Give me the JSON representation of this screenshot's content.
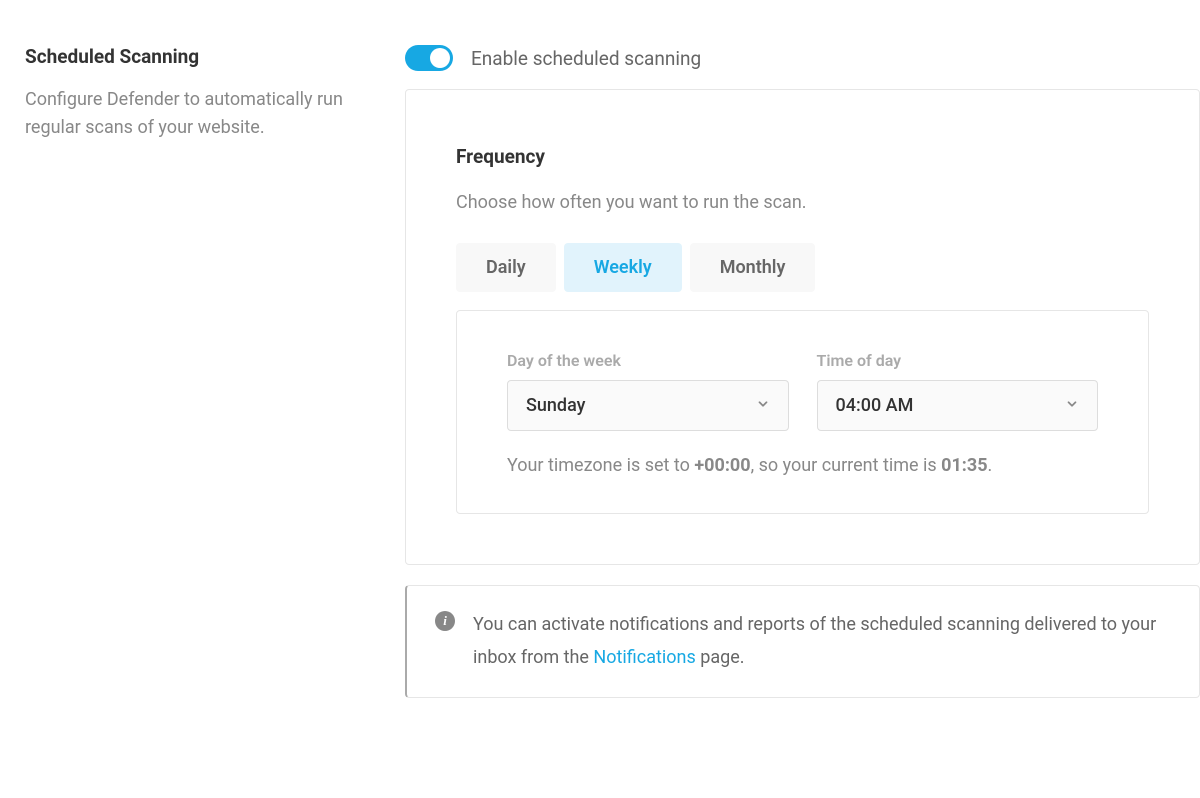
{
  "section": {
    "title": "Scheduled Scanning",
    "description": "Configure Defender to automatically run regular scans of your website."
  },
  "toggle": {
    "label": "Enable scheduled scanning",
    "checked": true
  },
  "frequency": {
    "heading": "Frequency",
    "subtext": "Choose how often you want to run the scan.",
    "tabs": {
      "daily": "Daily",
      "weekly": "Weekly",
      "monthly": "Monthly",
      "active": "weekly"
    },
    "day_label": "Day of the week",
    "day_value": "Sunday",
    "time_label": "Time of day",
    "time_value": "04:00 AM",
    "tz_prefix": "Your timezone is set to ",
    "tz_value": "+00:00",
    "tz_mid": ", so your current time is ",
    "tz_time": "01:35",
    "tz_suffix": "."
  },
  "info": {
    "text_before": "You can activate notifications and reports of the scheduled scanning delivered to your inbox from the ",
    "link": "Notifications",
    "text_after": " page."
  }
}
